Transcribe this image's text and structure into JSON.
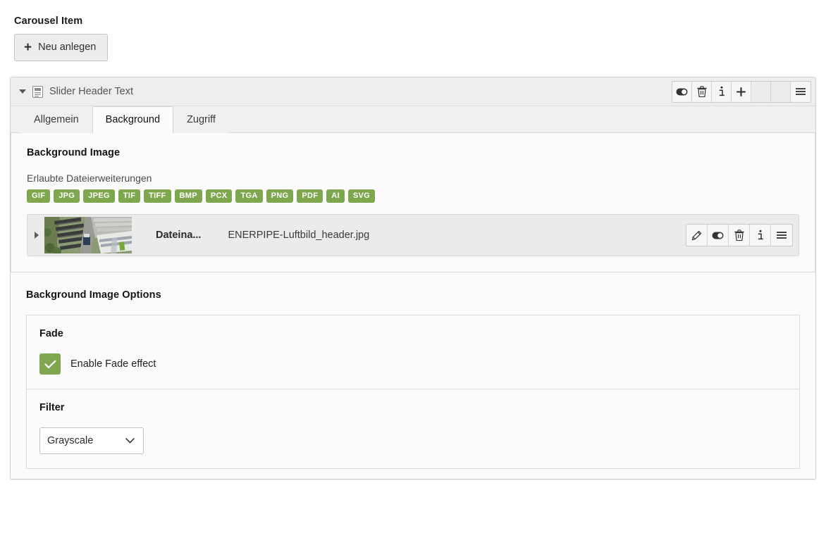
{
  "page": {
    "section_title": "Carousel Item",
    "new_button": {
      "label": "Neu anlegen",
      "icon": "plus-icon"
    }
  },
  "record": {
    "title": "Slider Header Text",
    "collapse_icon": "caret-down-icon",
    "type_icon": "content-element-icon",
    "toolbar": [
      {
        "name": "toggle-visibility-button",
        "icon": "toggle-icon"
      },
      {
        "name": "delete-button",
        "icon": "trash-icon"
      },
      {
        "name": "info-button",
        "icon": "info-icon"
      },
      {
        "name": "new-button",
        "icon": "plus-icon"
      },
      {
        "name": "empty-slot-1",
        "icon": ""
      },
      {
        "name": "empty-slot-2",
        "icon": ""
      },
      {
        "name": "drag-handle",
        "icon": "hamburger-icon"
      }
    ],
    "tabs": [
      {
        "label": "Allgemein",
        "active": false
      },
      {
        "label": "Background",
        "active": true
      },
      {
        "label": "Zugriff",
        "active": false
      }
    ]
  },
  "background_image": {
    "block_title": "Background Image",
    "allowed_label": "Erlaubte Dateierweiterungen",
    "allowed_extensions": [
      "GIF",
      "JPG",
      "JPEG",
      "TIF",
      "TIFF",
      "BMP",
      "PCX",
      "TGA",
      "PNG",
      "PDF",
      "AI",
      "SVG"
    ],
    "badge_color": "#7fa74f",
    "file": {
      "expand_icon": "caret-right-icon",
      "thumbnail_alt": "aerial-photo-industrial-building",
      "field_label": "Dateina...",
      "file_name": "ENERPIPE-Luftbild_header.jpg",
      "actions": [
        {
          "name": "edit-button",
          "icon": "pencil-icon"
        },
        {
          "name": "toggle-visibility-button",
          "icon": "toggle-icon"
        },
        {
          "name": "delete-button",
          "icon": "trash-icon"
        },
        {
          "name": "info-button",
          "icon": "info-icon"
        },
        {
          "name": "drag-handle",
          "icon": "hamburger-icon"
        }
      ]
    }
  },
  "background_image_options": {
    "block_title": "Background Image Options",
    "fade": {
      "title": "Fade",
      "checkbox_label": "Enable Fade effect",
      "checked": true,
      "check_color": "#7fa74f"
    },
    "filter": {
      "title": "Filter",
      "selected": "Grayscale",
      "options": [
        "Grayscale"
      ]
    }
  }
}
